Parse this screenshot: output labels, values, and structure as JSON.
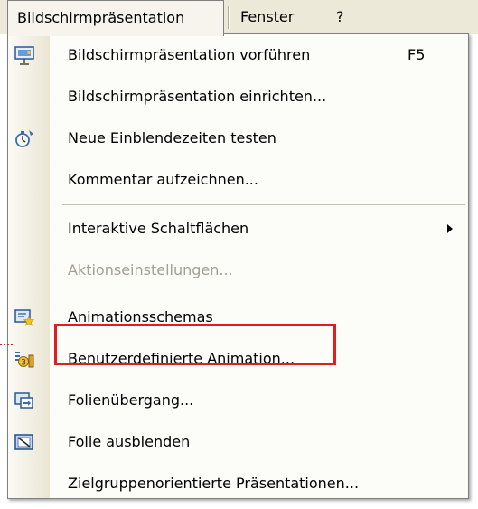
{
  "menubar": {
    "items": [
      {
        "label": "Bildschirmpräsentation"
      },
      {
        "label": "Fenster"
      },
      {
        "label": "?"
      }
    ]
  },
  "menu": {
    "items": [
      {
        "label": "Bildschirmpräsentation vorführen",
        "shortcut": "F5",
        "icon": "slideshow-icon"
      },
      {
        "label": "Bildschirmpräsentation einrichten...",
        "icon": ""
      },
      {
        "label": "Neue Einblendezeiten testen",
        "icon": "stopwatch-icon"
      },
      {
        "label": "Kommentar aufzeichnen...",
        "icon": ""
      },
      {
        "label": "Interaktive Schaltflächen",
        "icon": "",
        "submenu": true
      },
      {
        "label": "Aktionseinstellungen...",
        "icon": "",
        "disabled": true
      },
      {
        "label": "Animationsschemas",
        "icon": "animation-schemes-icon"
      },
      {
        "label": "Benutzerdefinierte Animation...",
        "icon": "custom-animation-icon",
        "highlighted": true
      },
      {
        "label": "Folienübergang...",
        "icon": "slide-transition-icon"
      },
      {
        "label": "Folie ausblenden",
        "icon": "hide-slide-icon"
      },
      {
        "label": "Zielgruppenorientierte Präsentationen...",
        "icon": ""
      }
    ]
  },
  "colors": {
    "highlight_border": "#e01e1e",
    "disabled_text": "#a29f93"
  }
}
